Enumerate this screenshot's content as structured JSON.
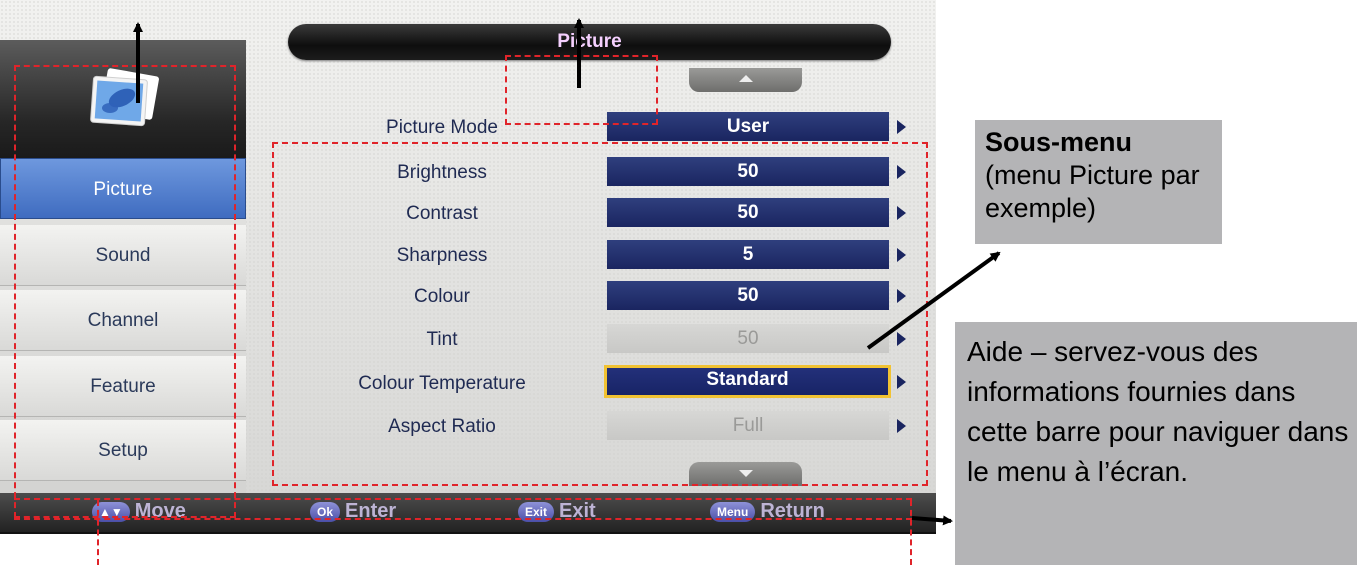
{
  "screen": {
    "title": "Picture",
    "sidebar": {
      "items": [
        {
          "label": "Picture",
          "active": true
        },
        {
          "label": "Sound",
          "active": false
        },
        {
          "label": "Channel",
          "active": false
        },
        {
          "label": "Feature",
          "active": false
        },
        {
          "label": "Setup",
          "active": false
        }
      ]
    },
    "settings": [
      {
        "label": "Picture Mode",
        "value": "User",
        "state": "normal"
      },
      {
        "label": "Brightness",
        "value": "50",
        "state": "normal"
      },
      {
        "label": "Contrast",
        "value": "50",
        "state": "normal"
      },
      {
        "label": "Sharpness",
        "value": "5",
        "state": "normal"
      },
      {
        "label": "Colour",
        "value": "50",
        "state": "normal"
      },
      {
        "label": "Tint",
        "value": "50",
        "state": "disabled"
      },
      {
        "label": "Colour Temperature",
        "value": "Standard",
        "state": "selected"
      },
      {
        "label": "Aspect Ratio",
        "value": "Full",
        "state": "disabled"
      }
    ],
    "help_bar": [
      {
        "key": "▲▼",
        "action": "Move"
      },
      {
        "key": "Ok",
        "action": "Enter"
      },
      {
        "key": "Exit",
        "action": "Exit"
      },
      {
        "key": "Menu",
        "action": "Return"
      }
    ]
  },
  "annotations": {
    "submenu_title": "Sous-menu",
    "submenu_desc": "(menu Picture par exemple)",
    "help_desc": "Aide – servez-vous des informations fournies dans cette barre pour naviguer dans le menu  à l’écran."
  },
  "colors": {
    "annotation_dash": "#e0242a",
    "callout_bg": "#b4b4b6",
    "active_tab": "#4a78cc",
    "value_bar": "#1f2a64",
    "selection_border": "#f1c232"
  }
}
